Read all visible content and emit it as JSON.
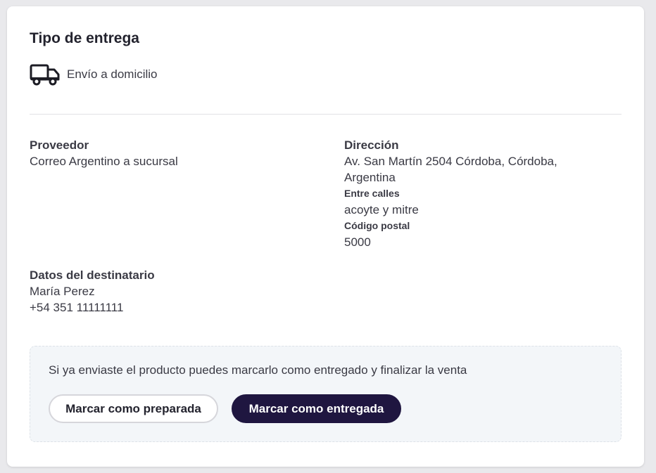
{
  "delivery": {
    "title": "Tipo de entrega",
    "type_icon": "truck-icon",
    "type_label": "Envío a domicilio"
  },
  "provider": {
    "label": "Proveedor",
    "value": "Correo Argentino a sucursal"
  },
  "address": {
    "label": "Dirección",
    "line1": "Av. San Martín 2504 Córdoba, Córdoba,",
    "line2": "Argentina",
    "between_streets_label": "Entre calles",
    "between_streets_value": "acoyte y mitre",
    "postal_code_label": "Código postal",
    "postal_code_value": "5000"
  },
  "recipient": {
    "label": "Datos del destinatario",
    "name": "María Perez",
    "phone": "+54 351 11111111"
  },
  "notice": {
    "text": "Si ya enviaste el producto puedes marcarlo como entregado y finalizar la venta",
    "mark_prepared_label": "Marcar como preparada",
    "mark_delivered_label": "Marcar como entregada"
  },
  "colors": {
    "primary_button": "#1f1640",
    "notice_background": "#f3f6f9"
  }
}
